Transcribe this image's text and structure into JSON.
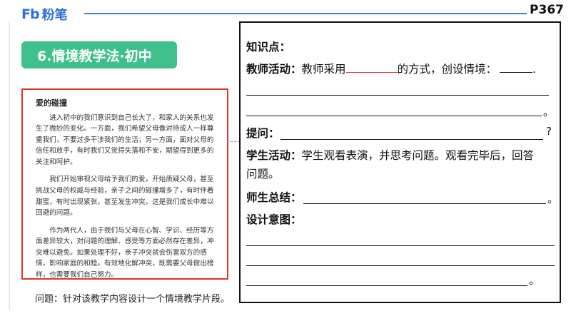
{
  "header": {
    "logo_mark": "Fb",
    "logo_text": "粉笔",
    "page_number": "P367"
  },
  "section_title": "6.情境教学法·初中",
  "passage": {
    "title": "爱的碰撞",
    "paragraphs": [
      "进入初中的我们意识到自己长大了，和家人的关系也发生了微妙的变化。一方面，我们希望父母像对待成人一样尊重我们，不要过多干涉我们的生活；另一方面，面对父母的信任和放手，有时我们又觉得失落和不安，期望得到更多的关注和呵护。",
      "我们开始审视父母给予我们的爱，开始质疑父母，甚至挑战父母的权威与经验，亲子之间的碰撞增多了，有时伴着甜蜜，有时出现紧张，甚至发生冲突。这是我们成长中难以回避的问题。",
      "作为两代人，由于我们与父母在心智、学识、经历等方面差异较大，对问题的理解、感受等方面必然存在差异，冲突难以避免。如果处理不好，亲子冲突就会伤害双方的感情，影响家庭的和睦。有效地化解冲突，既需要父母做出榜样，也需要我们自己努力。"
    ]
  },
  "question": "问题：针对该教学内容设计一个情境教学片段。",
  "panel": {
    "knowledge_label": "知识点：",
    "teacher_label": "教师活动：",
    "teacher_text_a": "教师采用",
    "teacher_text_b": "的方式，创设情境：",
    "teacher_end": ".",
    "period": "。",
    "question_label": "提问：",
    "question_mark": "?",
    "student_label": "学生活动：",
    "student_text_1": "学生观看表演，并思考问题。观看完毕后，回答",
    "student_text_2": "问题。",
    "summary_label": "师生总结：",
    "design_label": "设计意图："
  },
  "colors": {
    "title_green": "#3fc08a",
    "passage_border_red": "#e0342d",
    "brand_blue": "#2f6fd8"
  }
}
